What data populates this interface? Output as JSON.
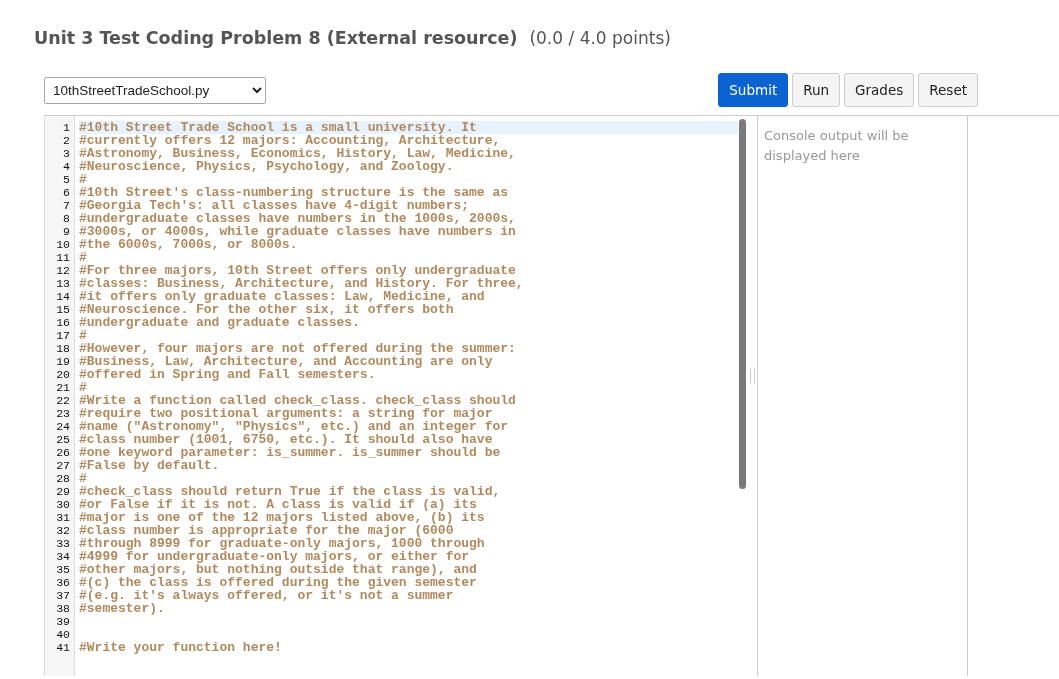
{
  "header": {
    "title": "Unit 3 Test Coding Problem 8 (External resource)",
    "score": "(0.0 / 4.0 points)"
  },
  "toolbar": {
    "file_select": {
      "value": "10thStreetTradeSchool.py"
    },
    "buttons": [
      {
        "label": "Submit",
        "kind": "primary"
      },
      {
        "label": "Run",
        "kind": "default"
      },
      {
        "label": "Grades",
        "kind": "default"
      },
      {
        "label": "Reset",
        "kind": "default"
      }
    ]
  },
  "editor": {
    "lines": [
      {
        "number": "1",
        "text": "#10th Street Trade School is a small university. It",
        "highlighted": true
      },
      {
        "number": "2",
        "text": "#currently offers 12 majors: Accounting, Architecture,",
        "highlighted": false
      },
      {
        "number": "3",
        "text": "#Astronomy, Business, Economics, History, Law, Medicine,",
        "highlighted": false
      },
      {
        "number": "4",
        "text": "#Neuroscience, Physics, Psychology, and Zoology.",
        "highlighted": false
      },
      {
        "number": "5",
        "text": "#",
        "highlighted": false
      },
      {
        "number": "6",
        "text": "#10th Street's class-numbering structure is the same as",
        "highlighted": false
      },
      {
        "number": "7",
        "text": "#Georgia Tech's: all classes have 4-digit numbers;",
        "highlighted": false
      },
      {
        "number": "8",
        "text": "#undergraduate classes have numbers in the 1000s, 2000s,",
        "highlighted": false
      },
      {
        "number": "9",
        "text": "#3000s, or 4000s, while graduate classes have numbers in",
        "highlighted": false
      },
      {
        "number": "10",
        "text": "#the 6000s, 7000s, or 8000s.",
        "highlighted": false
      },
      {
        "number": "11",
        "text": "#",
        "highlighted": false
      },
      {
        "number": "12",
        "text": "#For three majors, 10th Street offers only undergraduate",
        "highlighted": false
      },
      {
        "number": "13",
        "text": "#classes: Business, Architecture, and History. For three,",
        "highlighted": false
      },
      {
        "number": "14",
        "text": "#it offers only graduate classes: Law, Medicine, and",
        "highlighted": false
      },
      {
        "number": "15",
        "text": "#Neuroscience. For the other six, it offers both",
        "highlighted": false
      },
      {
        "number": "16",
        "text": "#undergraduate and graduate classes.",
        "highlighted": false
      },
      {
        "number": "17",
        "text": "#",
        "highlighted": false
      },
      {
        "number": "18",
        "text": "#However, four majors are not offered during the summer:",
        "highlighted": false
      },
      {
        "number": "19",
        "text": "#Business, Law, Architecture, and Accounting are only",
        "highlighted": false
      },
      {
        "number": "20",
        "text": "#offered in Spring and Fall semesters.",
        "highlighted": false
      },
      {
        "number": "21",
        "text": "#",
        "highlighted": false
      },
      {
        "number": "22",
        "text": "#Write a function called check_class. check_class should",
        "highlighted": false
      },
      {
        "number": "23",
        "text": "#require two positional arguments: a string for major",
        "highlighted": false
      },
      {
        "number": "24",
        "text": "#name (\"Astronomy\", \"Physics\", etc.) and an integer for",
        "highlighted": false
      },
      {
        "number": "25",
        "text": "#class number (1001, 6750, etc.). It should also have",
        "highlighted": false
      },
      {
        "number": "26",
        "text": "#one keyword parameter: is_summer. is_summer should be",
        "highlighted": false
      },
      {
        "number": "27",
        "text": "#False by default.",
        "highlighted": false
      },
      {
        "number": "28",
        "text": "#",
        "highlighted": false
      },
      {
        "number": "29",
        "text": "#check_class should return True if the class is valid,",
        "highlighted": false
      },
      {
        "number": "30",
        "text": "#or False if it is not. A class is valid if (a) its",
        "highlighted": false
      },
      {
        "number": "31",
        "text": "#major is one of the 12 majors listed above, (b) its",
        "highlighted": false
      },
      {
        "number": "32",
        "text": "#class number is appropriate for the major (6000",
        "highlighted": false
      },
      {
        "number": "33",
        "text": "#through 8999 for graduate-only majors, 1000 through",
        "highlighted": false
      },
      {
        "number": "34",
        "text": "#4999 for undergraduate-only majors, or either for",
        "highlighted": false
      },
      {
        "number": "35",
        "text": "#other majors, but nothing outside that range), and",
        "highlighted": false
      },
      {
        "number": "36",
        "text": "#(c) the class is offered during the given semester",
        "highlighted": false
      },
      {
        "number": "37",
        "text": "#(e.g. it's always offered, or it's not a summer",
        "highlighted": false
      },
      {
        "number": "38",
        "text": "#semester).",
        "highlighted": false
      },
      {
        "number": "39",
        "highlighted": false
      },
      {
        "number": "40",
        "highlighted": false
      },
      {
        "number": "41",
        "text": "#Write your function here!",
        "highlighted": false
      }
    ]
  },
  "console": {
    "placeholder": "Console output will be displayed here"
  }
}
